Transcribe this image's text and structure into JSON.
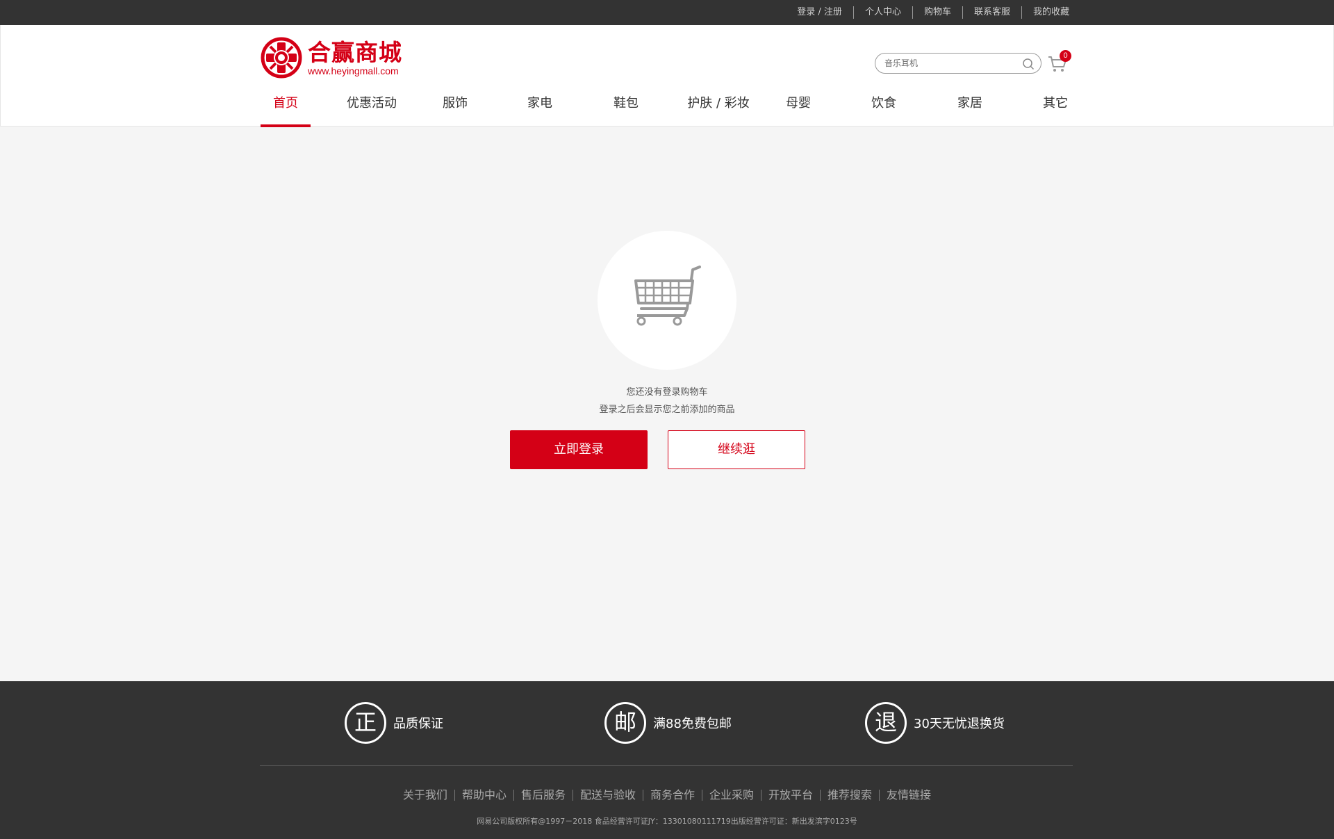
{
  "topbar": {
    "links": [
      "登录 / 注册",
      "个人中心",
      "购物车",
      "联系客服",
      "我的收藏"
    ]
  },
  "logo": {
    "title": "合赢商城",
    "url": "www.heyingmall.com"
  },
  "search": {
    "placeholder": "音乐耳机"
  },
  "cart": {
    "count": "0"
  },
  "nav": {
    "items": [
      "首页",
      "优惠活动",
      "服饰",
      "家电",
      "鞋包",
      "护肤 / 彩妆",
      "母婴",
      "饮食",
      "家居",
      "其它"
    ],
    "active_index": 0
  },
  "empty_cart": {
    "line1": "您还没有登录购物车",
    "line2": "登录之后会显示您之前添加的商品",
    "login_button": "立即登录",
    "continue_button": "继续逛"
  },
  "footer": {
    "promises": [
      {
        "icon_char": "正",
        "label": "品质保证"
      },
      {
        "icon_char": "邮",
        "label": "满88免费包邮"
      },
      {
        "icon_char": "退",
        "label": "30天无忧退换货"
      }
    ],
    "links": [
      "关于我们",
      "帮助中心",
      "售后服务",
      "配送与验收",
      "商务合作",
      "企业采购",
      "开放平台",
      "推荐搜索",
      "友情链接"
    ],
    "copyright": "网易公司版权所有@1997－2018  食品经营许可证JY：13301080111719出版经营许可证：新出发滨字0123号"
  },
  "colors": {
    "accent": "#d40016",
    "topbar_bg": "#333333",
    "page_bg": "#f5f5f5"
  }
}
